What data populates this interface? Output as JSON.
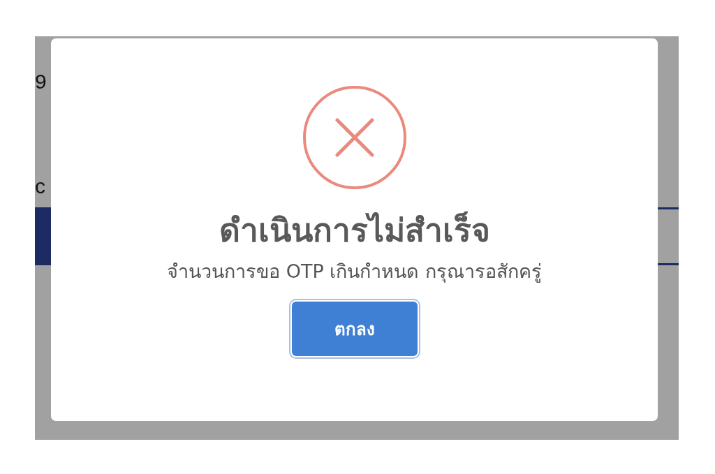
{
  "background_page": {
    "texts": [
      "9",
      "c"
    ]
  },
  "dialog": {
    "kind": "error",
    "title": "ดำเนินการไม่สำเร็จ",
    "message": "จำนวนการขอ OTP เกินกำหนด กรุณารอสักครู่",
    "buttons": [
      "ตกลง"
    ]
  }
}
